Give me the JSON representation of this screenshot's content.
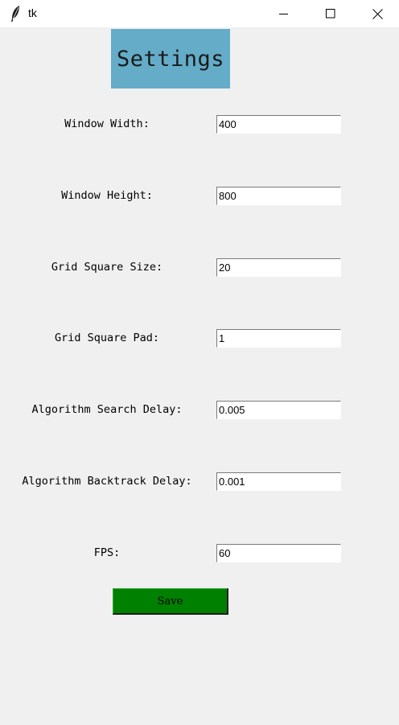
{
  "window": {
    "title": "tk",
    "icon": "feather-icon"
  },
  "header": {
    "title": "Settings",
    "background": "#64acc8"
  },
  "fields": [
    {
      "label": "Window Width:",
      "value": "400"
    },
    {
      "label": "Window Height:",
      "value": "800"
    },
    {
      "label": "Grid Square Size:",
      "value": "20"
    },
    {
      "label": "Grid Square Pad:",
      "value": "1"
    },
    {
      "label": "Algorithm Search Delay:",
      "value": "0.005"
    },
    {
      "label": "Algorithm Backtrack Delay:",
      "value": "0.001"
    },
    {
      "label": "FPS:",
      "value": "60"
    }
  ],
  "save": {
    "label": "Save",
    "color": "#008000"
  }
}
